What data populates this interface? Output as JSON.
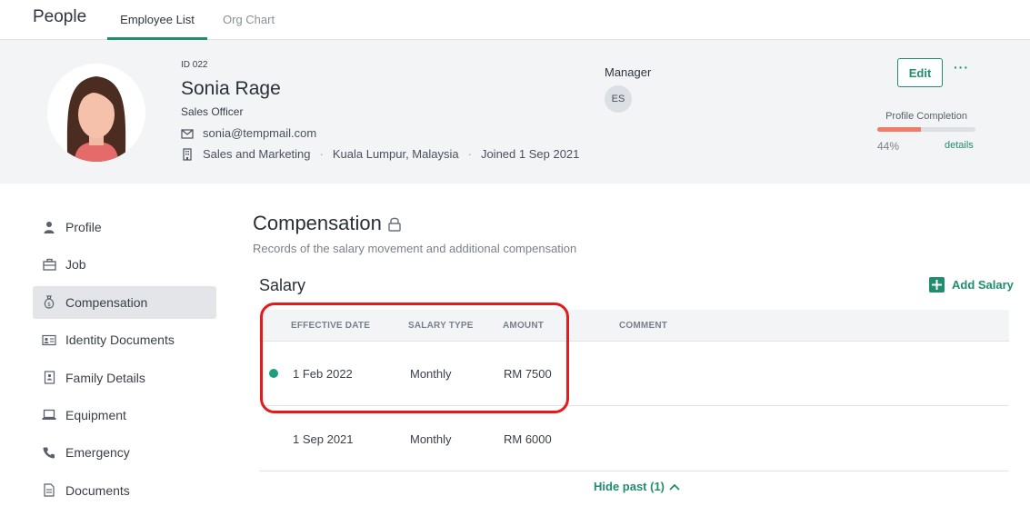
{
  "app": {
    "title": "People"
  },
  "tabs": {
    "employee_list": "Employee List",
    "org_chart": "Org Chart"
  },
  "employee": {
    "id": "ID 022",
    "name": "Sonia Rage",
    "role": "Sales Officer",
    "email": "sonia@tempmail.com",
    "department": "Sales and Marketing",
    "location": "Kuala Lumpur, Malaysia",
    "joined": "Joined 1 Sep 2021",
    "separator": "·"
  },
  "manager": {
    "label": "Manager",
    "initials": "ES"
  },
  "actions": {
    "edit": "Edit",
    "more": "···"
  },
  "profile_completion": {
    "label": "Profile Completion",
    "percent_text": "44%",
    "fraction": 0.44,
    "details": "details"
  },
  "sidebar": {
    "items": [
      {
        "label": "Profile",
        "icon": "person-icon"
      },
      {
        "label": "Job",
        "icon": "briefcase-icon"
      },
      {
        "label": "Compensation",
        "icon": "money-bag-icon",
        "active": true
      },
      {
        "label": "Identity Documents",
        "icon": "id-card-icon"
      },
      {
        "label": "Family Details",
        "icon": "family-document-icon"
      },
      {
        "label": "Equipment",
        "icon": "laptop-icon"
      },
      {
        "label": "Emergency",
        "icon": "phone-icon"
      },
      {
        "label": "Documents",
        "icon": "document-icon"
      }
    ]
  },
  "compensation": {
    "title": "Compensation",
    "subtitle": "Records of the salary movement and additional compensation"
  },
  "salary": {
    "title": "Salary",
    "add_label": "Add Salary",
    "columns": [
      "EFFECTIVE DATE",
      "SALARY TYPE",
      "AMOUNT",
      "COMMENT"
    ],
    "rows": [
      {
        "effective_date": "1 Feb 2022",
        "salary_type": "Monthly",
        "amount": "RM 7500",
        "comment": "",
        "current": true
      },
      {
        "effective_date": "1 Sep 2021",
        "salary_type": "Monthly",
        "amount": "RM 6000",
        "comment": "",
        "current": false
      }
    ],
    "hide_past": "Hide past (1)"
  },
  "colors": {
    "accent": "#1f8d6e",
    "progress": "#ef7c67",
    "highlight": "#e31b1b",
    "current_dot": "#1f9e7e"
  }
}
